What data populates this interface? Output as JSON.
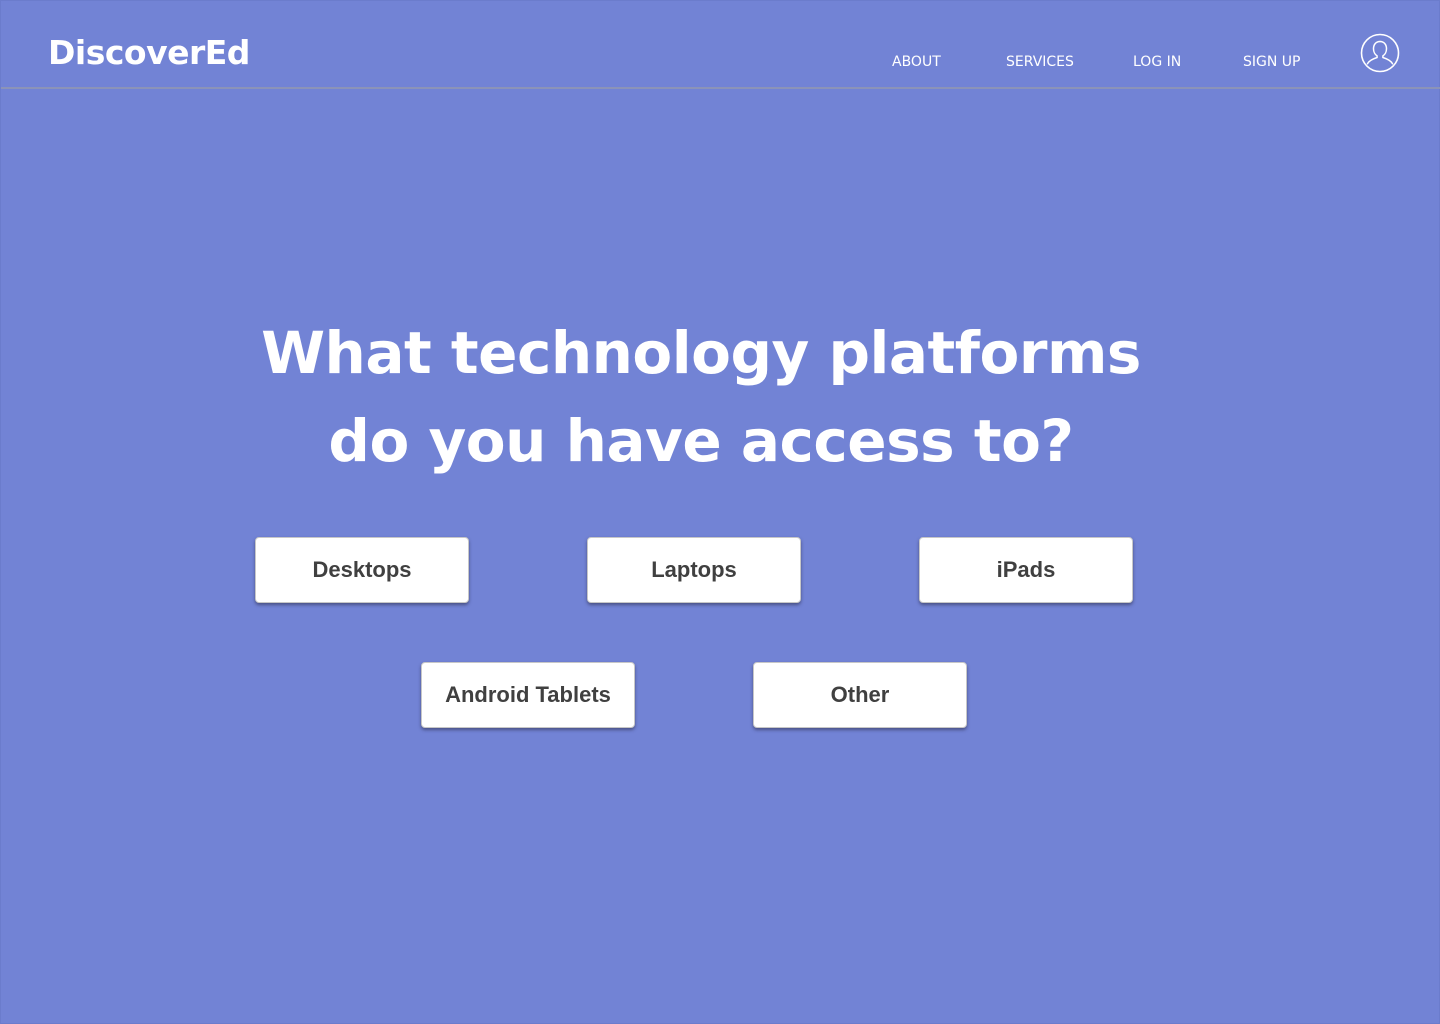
{
  "header": {
    "logo": "DiscoverEd",
    "nav": {
      "about": "ABOUT",
      "services": "SERVICES",
      "login": "LOG IN",
      "signup": "SIGN UP"
    },
    "avatar_icon": "user-avatar-icon"
  },
  "main": {
    "question_line1": "What technology platforms",
    "question_line2": "do you have access to?",
    "options": {
      "desktops": "Desktops",
      "laptops": "Laptops",
      "ipads": "iPads",
      "android": "Android Tablets",
      "other": "Other"
    }
  },
  "colors": {
    "background": "#7283d5",
    "button_bg": "#ffffff",
    "button_text": "#404040",
    "header_divider": "#8b93b8"
  }
}
